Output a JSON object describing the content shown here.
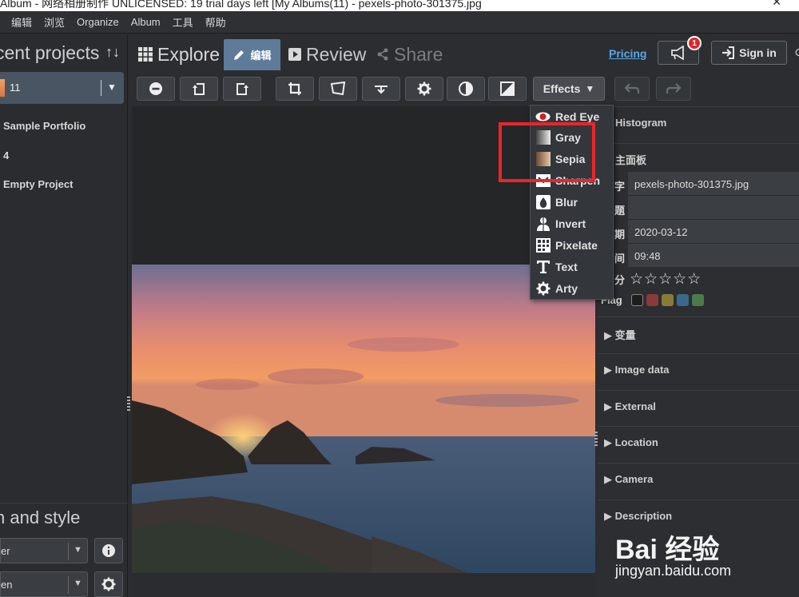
{
  "window": {
    "title": "Album - 网络相册制作 UNLICENSED: 19 trial days left [My Albums(11) - pexels-photo-301375.jpg",
    "close": "✕"
  },
  "menubar": [
    "编辑",
    "浏览",
    "Organize",
    "Album",
    "工具",
    "帮助"
  ],
  "left": {
    "header": "cent projects",
    "sort_icon": "↑↓",
    "selected_project": {
      "count": "11"
    },
    "projects": [
      "Sample Portfolio",
      "4",
      "Empty Project"
    ],
    "style_header": "n and style",
    "select1": "er",
    "select2": "en"
  },
  "tabs": {
    "explore": "Explore",
    "edit": "编辑",
    "review": "Review",
    "share": "Share"
  },
  "header_right": {
    "pricing": "Pricing",
    "notifications": "1",
    "signin": "Sign in"
  },
  "toolbar": {
    "effects": "Effects"
  },
  "effects_menu": [
    "Red Eye",
    "Gray",
    "Sepia",
    "Sharpen",
    "Blur",
    "Invert",
    "Pixelate",
    "Text",
    "Arty"
  ],
  "right": {
    "histogram": "Histogram",
    "main_panel": "主面板",
    "meta": [
      {
        "key": "字",
        "value": "pexels-photo-301375.jpg"
      },
      {
        "key": "题",
        "value": ""
      },
      {
        "key": "期",
        "value": "2020-03-12"
      },
      {
        "key": "间",
        "value": "09:48"
      }
    ],
    "rating_key": "分",
    "stars": "☆☆☆☆☆",
    "flag_key": "Flag",
    "flag_colors": [
      "#1e1e1e",
      "#8a3a3a",
      "#8a7a3a",
      "#3a6a8a",
      "#4a7a4a"
    ],
    "sections": [
      "变量",
      "Image data",
      "External",
      "Location",
      "Camera",
      "Description"
    ]
  },
  "watermark": {
    "line1": "Bai 经验",
    "line2": "jingyan.baidu.com"
  }
}
